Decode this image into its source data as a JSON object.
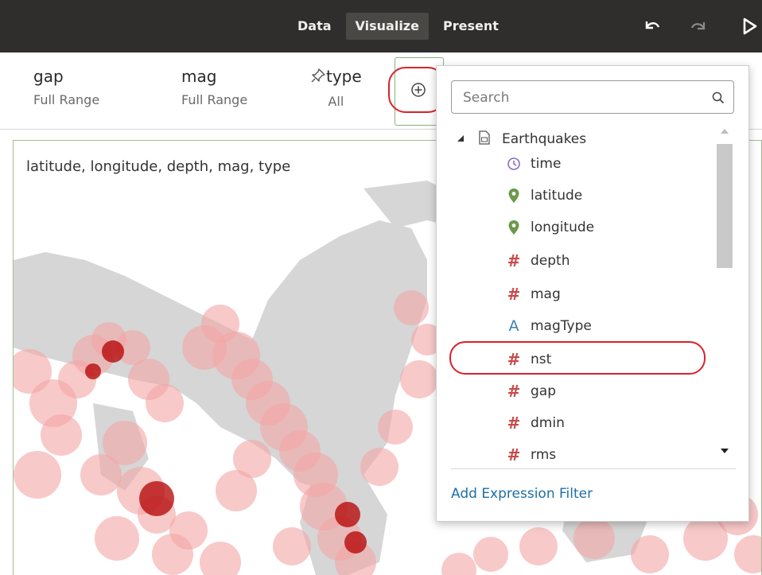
{
  "toolbar": {
    "tabs": [
      {
        "label": "Data",
        "active": false
      },
      {
        "label": "Visualize",
        "active": true
      },
      {
        "label": "Present",
        "active": false
      }
    ],
    "icons": [
      "undo-icon",
      "redo-icon",
      "play-icon"
    ]
  },
  "filters": [
    {
      "name": "gap",
      "value": "Full Range"
    },
    {
      "name": "mag",
      "value": "Full Range"
    },
    {
      "name": "type",
      "value": "All",
      "pinned": true
    }
  ],
  "visualization": {
    "title": "latitude, longitude, depth, mag, type"
  },
  "field_picker": {
    "search_placeholder": "Search",
    "dataset": "Earthquakes",
    "items": [
      {
        "label": "time",
        "icon": "clock-icon"
      },
      {
        "label": "latitude",
        "icon": "location-pin-icon"
      },
      {
        "label": "longitude",
        "icon": "location-pin-icon"
      },
      {
        "label": "depth",
        "icon": "hash-icon"
      },
      {
        "label": "mag",
        "icon": "hash-icon"
      },
      {
        "label": "magType",
        "icon": "attribute-a-icon"
      },
      {
        "label": "nst",
        "icon": "hash-icon",
        "highlighted": true
      },
      {
        "label": "gap",
        "icon": "hash-icon"
      },
      {
        "label": "dmin",
        "icon": "hash-icon"
      },
      {
        "label": "rms",
        "icon": "hash-icon"
      }
    ],
    "add_expression_label": "Add Expression Filter"
  },
  "colors": {
    "toolbar_bg": "#302e2c",
    "highlight_ring": "#d9222b",
    "link": "#1d6fa5",
    "map_land": "#d6d6d6",
    "bubble": "#f4a5a5",
    "bubble_dark": "#b30000"
  }
}
